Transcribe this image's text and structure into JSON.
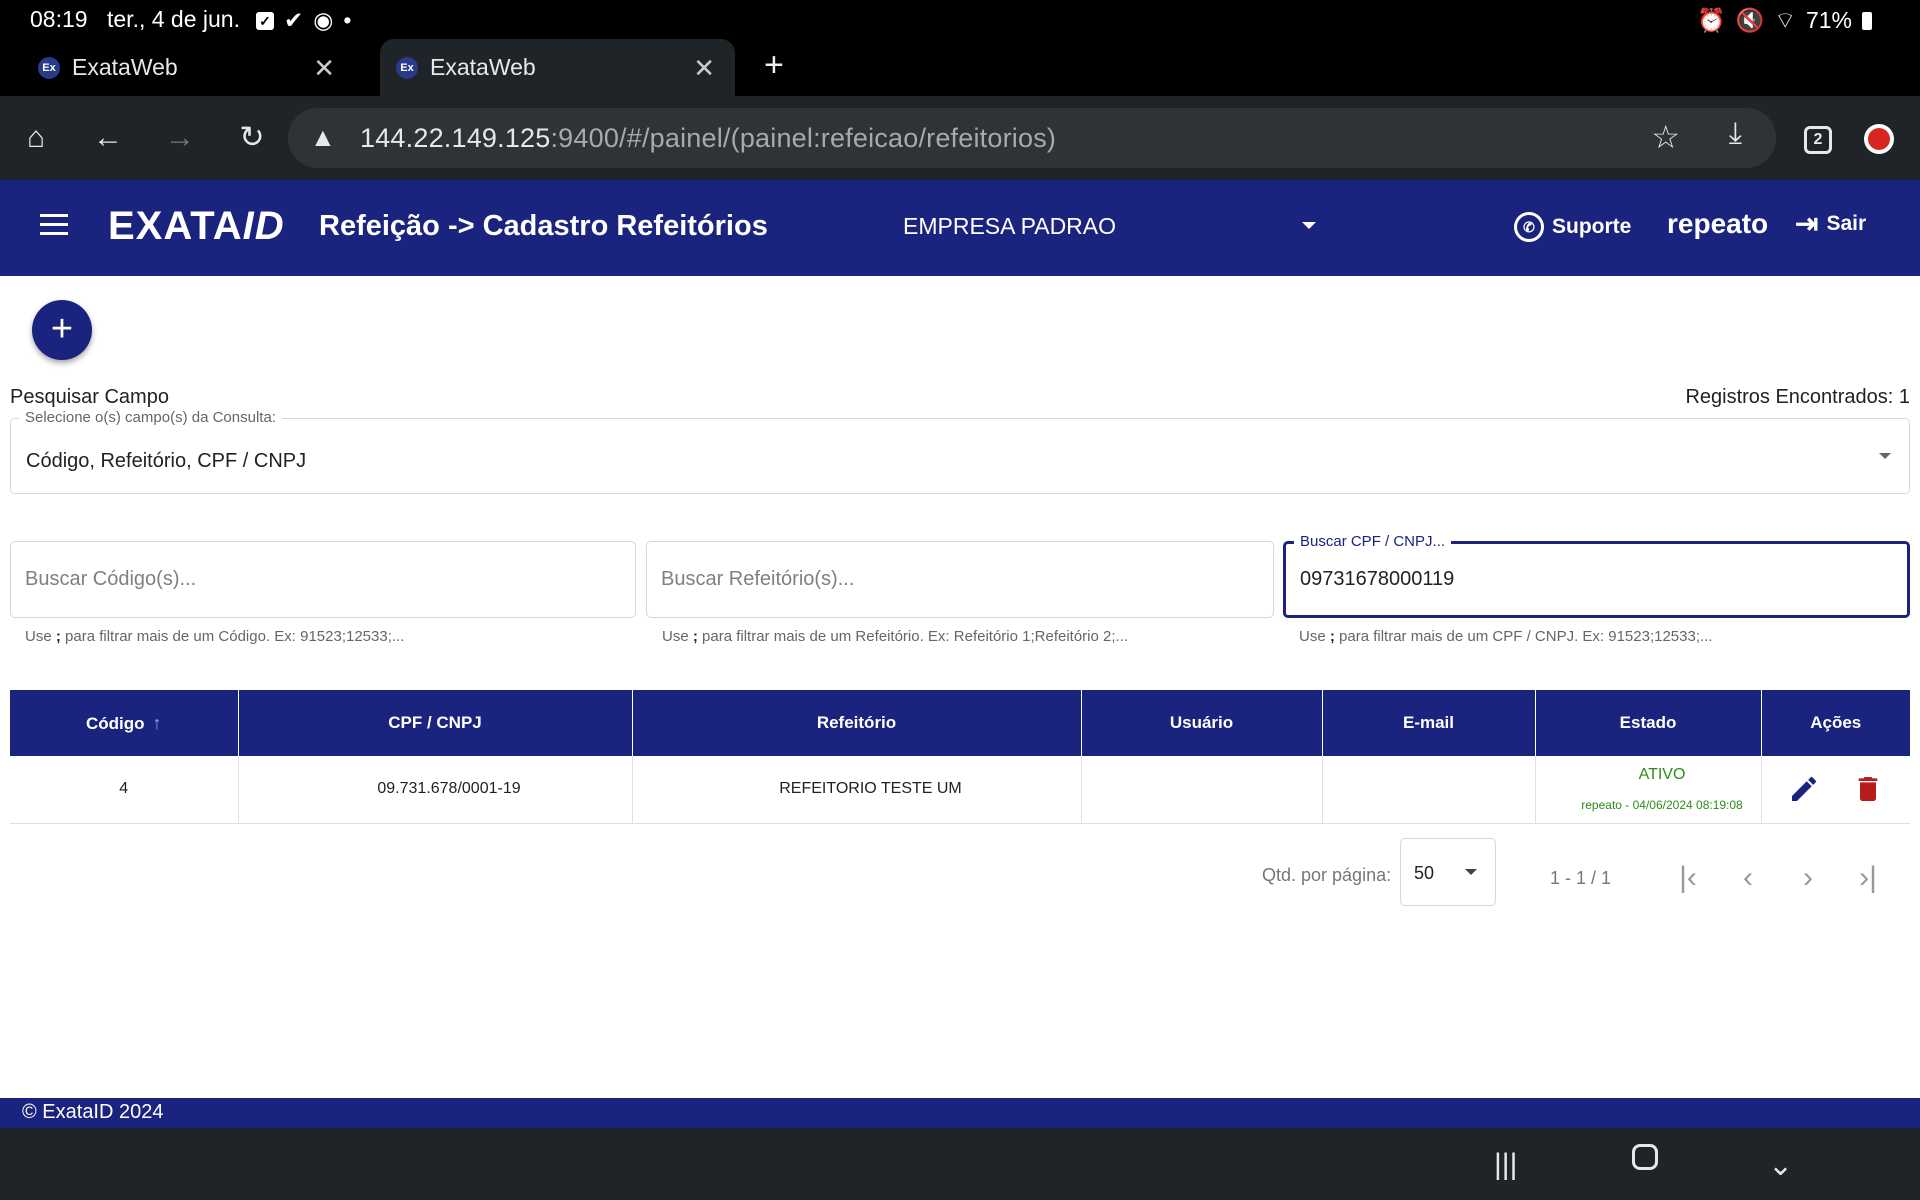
{
  "status_bar": {
    "time": "08:19",
    "date": "ter., 4 de jun.",
    "battery": "71%"
  },
  "browser": {
    "tabs": [
      {
        "title": "ExataWeb",
        "favicon": "Ex",
        "active": false
      },
      {
        "title": "ExataWeb",
        "favicon": "Ex",
        "active": true
      }
    ],
    "url_host": "144.22.149.125",
    "url_rest": ":9400/#/painel/(painel:refeicao/refeitorios)",
    "tab_count": "2"
  },
  "app": {
    "logo_main": "EXATA",
    "logo_suffix": "ID",
    "title": "Refeição -> Cadastro Refeitórios",
    "company": "EMPRESA PADRAO",
    "support_label": "Suporte",
    "username": "repeato",
    "logout_label": "Sair",
    "colors": {
      "primary": "#1a237e",
      "status_green": "#2e8b1a",
      "delete_red": "#b71c1c"
    }
  },
  "search": {
    "caption": "Pesquisar Campo",
    "records_found": "Registros Encontrados: 1",
    "fields_legend": "Selecione o(s) campo(s) da Consulta:",
    "fields_value": "Código, Refeitório, CPF / CNPJ",
    "codigo": {
      "placeholder": "Buscar Código(s)...",
      "hint_pre": "Use ",
      "hint_sep": ";",
      "hint_post": " para filtrar mais de um Código. Ex: 91523;12533;..."
    },
    "refeitorio": {
      "placeholder": "Buscar Refeitório(s)...",
      "hint_pre": "Use ",
      "hint_sep": ";",
      "hint_post": " para filtrar mais de um Refeitório. Ex: Refeitório 1;Refeitório 2;..."
    },
    "cpf": {
      "legend": "Buscar CPF / CNPJ...",
      "value": "09731678000119",
      "hint_pre": "Use ",
      "hint_sep": ";",
      "hint_post": " para filtrar mais de um CPF / CNPJ. Ex: 91523;12533;..."
    }
  },
  "table": {
    "headers": [
      "Código",
      "CPF / CNPJ",
      "Refeitório",
      "Usuário",
      "E-mail",
      "Estado",
      "Ações"
    ],
    "rows": [
      {
        "codigo": "4",
        "cpf_cnpj": "09.731.678/0001-19",
        "refeitorio": "REFEITORIO TESTE UM",
        "usuario": "",
        "email": "",
        "estado": "ATIVO",
        "estado_detail": "repeato - 04/06/2024 08:19:08"
      }
    ]
  },
  "paginator": {
    "label": "Qtd. por página:",
    "page_size": "50",
    "range": "1 - 1 / 1"
  },
  "footer": {
    "text": "© ExataID 2024"
  }
}
